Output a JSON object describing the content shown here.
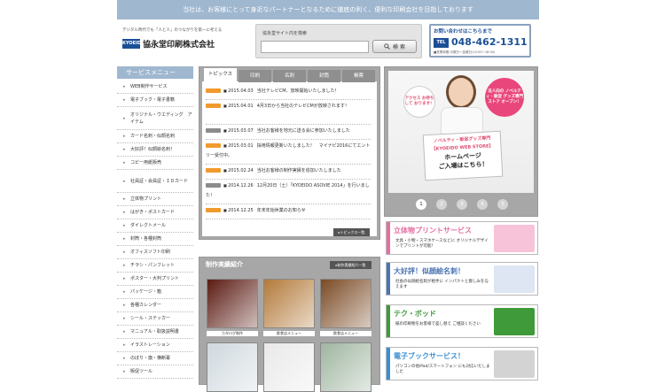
{
  "top_banner": "当社は、お客様にとって身近なパートナーとなるために徹底の利く、便利な印刷会社を目指しております",
  "header": {
    "tagline": "デジタル時代でも「人と人」のつながりを第一に考える",
    "logo_mark": "KYOEIDO",
    "company_name": "協永堂印刷株式会社",
    "search_label": "協永堂サイト内を検索",
    "search_placeholder": "",
    "search_button": "検 索",
    "contact_label": "お問い合わせはこちらまで",
    "tel_badge": "TEL",
    "tel_number": "048-462-1311",
    "tel_hours": "■営業時間:月曜日～金曜日(10:00～18:00)"
  },
  "sidebar": {
    "heading": "サービスメニュー",
    "items": [
      "WEB制作サービス",
      "電子ブック・電子書籍",
      "オリジナル・ウエディング　アイテム",
      "カード名刺・似顔名刺",
      "大好評！似顔絵名刺！",
      "コピー用紙販売",
      "社員証・会員証・ＩＤカード",
      "立体物プリント",
      "はがき・ポストカード",
      "ダイレクトメール",
      "封筒・各種封筒",
      "オフィスソフト印刷",
      "チラシ・パンフレット",
      "ポスター・大判プリント",
      "パッケージ・箱",
      "各種カレンダー",
      "シール・ステッカー",
      "マニュアル・取扱説明書",
      "イラストレーション",
      "のぼり・旗・横断幕",
      "販促ツール"
    ]
  },
  "topics": {
    "tabs": [
      "トピックス",
      "印刷",
      "名刺",
      "封筒",
      "帳票"
    ],
    "news": [
      {
        "date": "2015.04.03",
        "text": "当社テレビCM、放映開始いたしました！",
        "badge_color": "#f19a2d"
      },
      {
        "date": "2015.04.01",
        "text": "4月3日から当社のテレビCMが放映されます！",
        "badge_color": "#f19a2d"
      },
      {
        "date": "2015.03.07",
        "text": "当社お客様を地元に送る会に参加いたしました",
        "badge_color": "#8c8c8c"
      },
      {
        "date": "2015.03.01",
        "text": "採用情報更新いたしました！　マイナビ2016にてエントリー受付中。",
        "badge_color": "#f19a2d"
      },
      {
        "date": "2015.02.24",
        "text": "当社お客様の制作実績を追加いたしました",
        "badge_color": "#f19a2d"
      },
      {
        "date": "2014.12.26",
        "text": "12月20日（土）「KYOEIDO ASOVIE 2014」を行いました！",
        "badge_color": "#8c8c8c"
      },
      {
        "date": "2014.12.25",
        "text": "年末年始休業のお知らせ",
        "badge_color": "#f19a2d"
      }
    ],
    "more_button": "▸トピックス一覧"
  },
  "works": {
    "title": "制作実績紹介",
    "more_button": "▸制作実績紹介一覧",
    "items": [
      {
        "caption": "カタログ制作",
        "color": "#5a1a12"
      },
      {
        "caption": "飲食店メニュー",
        "color": "#b37a3a"
      },
      {
        "caption": "飲食店メニュー",
        "color": "#7a4a25"
      },
      {
        "caption": "",
        "color": "#cfd8de"
      },
      {
        "caption": "",
        "color": "#e9e9e9"
      },
      {
        "caption": "",
        "color": "#9fb5a0"
      }
    ]
  },
  "hero": {
    "bubble_left": "アクセス お待ちして おります！",
    "bubble_right": "法人向の ノベルティ・販促 グッズ専門ストア オープン！",
    "sign_line1": "ノベルティ・販促グッズ専門",
    "sign_line2": "【KYOEIDO WEB STORE】",
    "sign_line3": "ホームページ",
    "sign_line4": "ご入場はこちら！",
    "pager": [
      "1",
      "2",
      "3",
      "4",
      "5"
    ],
    "active_page": "1"
  },
  "banners": [
    {
      "title": "立体物プリントサービス",
      "desc": "文具・小物・スマホケースなどに オリジナルデザインでプリントが可能！",
      "color": "#e46fa1",
      "art_color": "#f7c3d8"
    },
    {
      "title": "大好評！似顔絵名刺！",
      "desc": "社長の似顔絵名刺が相手に インパクトと親しみを与えます",
      "color": "#4b74b3",
      "art_color": "#dde6f2"
    },
    {
      "title": "テク・ボッド",
      "desc": "紙の印刷物をお客様で差し替え ご相談ください",
      "color": "#3f9a3a",
      "art_color": "#3f9a3a"
    },
    {
      "title": "電子ブックサービス！",
      "desc": "パソコンの他iPad/スマートフォン にも対応いたしました",
      "color": "#3b8fd1",
      "art_color": "#d3d3d3"
    }
  ]
}
